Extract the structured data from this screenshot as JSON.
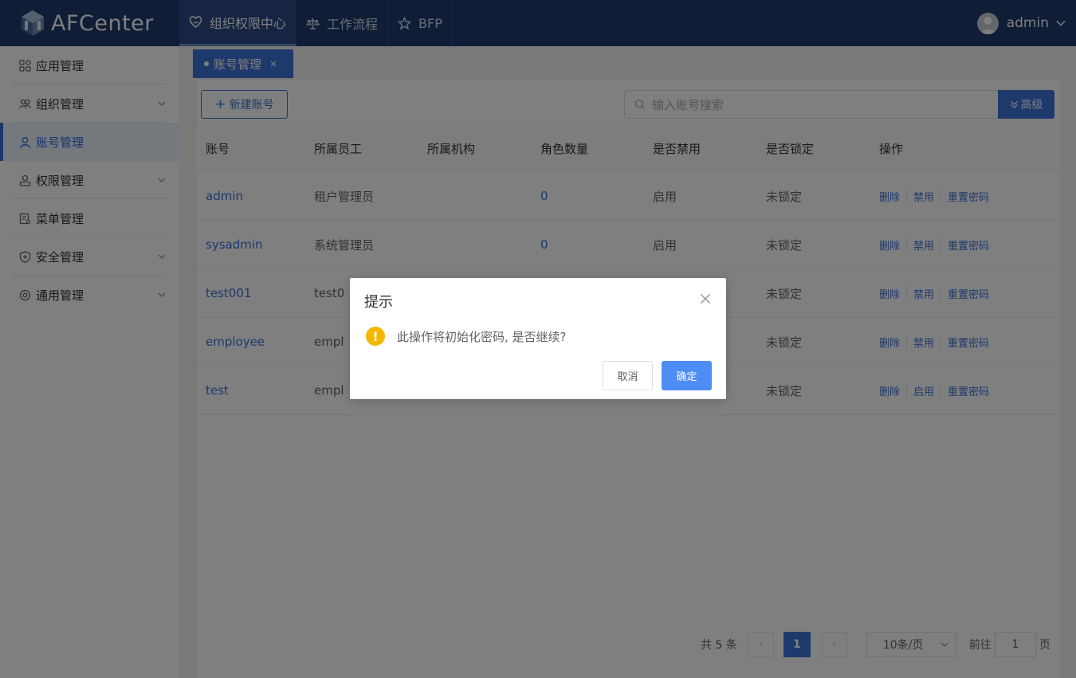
{
  "app": {
    "title": "AFCenter"
  },
  "topnav": [
    {
      "label": "组织权限中心",
      "icon": "heart-shield-icon",
      "active": true
    },
    {
      "label": "工作流程",
      "icon": "scale-icon",
      "active": false
    },
    {
      "label": "BFP",
      "icon": "star-icon",
      "active": false
    }
  ],
  "user": {
    "name": "admin"
  },
  "sidebar": {
    "items": [
      {
        "label": "应用管理",
        "icon": "apps-grid-icon",
        "expandable": false
      },
      {
        "label": "组织管理",
        "icon": "users-icon",
        "expandable": true
      },
      {
        "label": "账号管理",
        "icon": "user-icon",
        "expandable": false,
        "active": true
      },
      {
        "label": "权限管理",
        "icon": "permission-icon",
        "expandable": true
      },
      {
        "label": "菜单管理",
        "icon": "menu-doc-icon",
        "expandable": false
      },
      {
        "label": "安全管理",
        "icon": "shield-plus-icon",
        "expandable": true
      },
      {
        "label": "通用管理",
        "icon": "settings-icon",
        "expandable": true
      }
    ]
  },
  "tab": {
    "label": "账号管理",
    "close": "×"
  },
  "toolbar": {
    "new_label": "新建账号",
    "search_placeholder": "输入账号搜索",
    "advanced_label": "高级"
  },
  "table": {
    "headers": [
      "账号",
      "所属员工",
      "所属机构",
      "角色数量",
      "是否禁用",
      "是否锁定",
      "操作"
    ],
    "rows": [
      {
        "account": "admin",
        "employee": "租户管理员",
        "org": "",
        "roles": "0",
        "disabled": "启用",
        "locked": "未锁定",
        "ops": [
          "删除",
          "禁用",
          "重置密码"
        ]
      },
      {
        "account": "sysadmin",
        "employee": "系统管理员",
        "org": "",
        "roles": "0",
        "disabled": "启用",
        "locked": "未锁定",
        "ops": [
          "删除",
          "禁用",
          "重置密码"
        ]
      },
      {
        "account": "test001",
        "employee": "test0",
        "org": "",
        "roles": "",
        "disabled": "",
        "locked": "未锁定",
        "ops": [
          "删除",
          "禁用",
          "重置密码"
        ]
      },
      {
        "account": "employee",
        "employee": "empl",
        "org": "",
        "roles": "",
        "disabled": "",
        "locked": "未锁定",
        "ops": [
          "删除",
          "禁用",
          "重置密码"
        ]
      },
      {
        "account": "test",
        "employee": "empl",
        "org": "",
        "roles": "",
        "disabled": "",
        "locked": "未锁定",
        "ops": [
          "删除",
          "启用",
          "重置密码"
        ]
      }
    ]
  },
  "pagination": {
    "total_text": "共 5 条",
    "current_page": "1",
    "page_size": "10条/页",
    "goto_label": "前往",
    "goto_value": "1",
    "page_suffix": "页"
  },
  "dialog": {
    "title": "提示",
    "message": "此操作将初始化密码, 是否继续?",
    "cancel_label": "取消",
    "confirm_label": "确定",
    "icon": "warning-icon"
  },
  "colors": {
    "header_bg": "#1f3a6e",
    "primary": "#3d72d8",
    "confirm": "#4e8cf6",
    "warning": "#f5b800"
  }
}
